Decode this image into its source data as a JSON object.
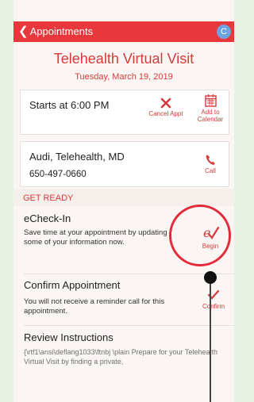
{
  "navbar": {
    "back_label": "Appointments",
    "avatar_letter": "C"
  },
  "header": {
    "title": "Telehealth Virtual Visit",
    "date": "Tuesday, March 19, 2019"
  },
  "time_card": {
    "starts_label": "Starts at 6:00 PM",
    "cancel_label": "Cancel Appt",
    "calendar_label_line1": "Add to",
    "calendar_label_line2": "Calendar"
  },
  "provider_card": {
    "name": "Audi, Telehealth, MD",
    "phone": "650-497-0660",
    "call_label": "Call"
  },
  "section": {
    "title": "GET READY"
  },
  "items": {
    "echeckin": {
      "title": "eCheck-In",
      "desc": "Save time at your appointment by updating some of your information now.",
      "action_label": "Begin"
    },
    "confirm": {
      "title": "Confirm Appointment",
      "desc": "You will not receive a reminder call for this appointment.",
      "action_label": "Confirm"
    },
    "review": {
      "title": "Review Instructions",
      "text": "{\\rtf1\\ansi\\deflang1033\\ftnbj \\plain Prepare for your Telehealth Virtual Visit by finding a private,"
    }
  },
  "colors": {
    "accent": "#e8383c",
    "text_red": "#d63b3b",
    "highlight": "#e22b3b",
    "background": "#e8f2e2"
  },
  "icons": {
    "back": "chevron-left-icon",
    "cancel": "close-icon",
    "calendar": "calendar-icon",
    "call": "phone-icon",
    "begin": "echeck-icon",
    "confirm": "checkmark-icon"
  }
}
